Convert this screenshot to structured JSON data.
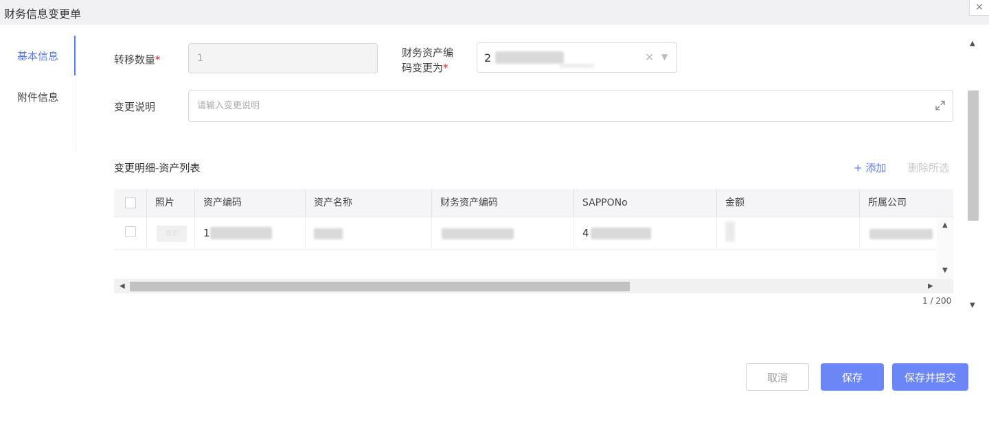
{
  "window": {
    "title": "财务信息变更单",
    "close_label": "✕"
  },
  "nav": {
    "items": [
      {
        "label": "基本信息",
        "active": true
      },
      {
        "label": "附件信息",
        "active": false
      }
    ]
  },
  "form": {
    "transfer_qty_label": "转移数量",
    "transfer_qty_value": "1",
    "fin_code_label_line1": "财务资产编",
    "fin_code_label_line2": "码变更为",
    "fin_code_value": "2",
    "change_desc_label": "变更说明",
    "change_desc_placeholder": "请输入变更说明",
    "required_mark": "*"
  },
  "detail": {
    "section_title": "变更明细-资产列表",
    "add_label": "+ 添加",
    "delete_selected_label": "删除所选",
    "columns": [
      "照片",
      "资产编码",
      "资产名称",
      "财务资产编码",
      "SAPPONo",
      "金额",
      "所属公司"
    ],
    "rows": [
      {
        "asset_code": "1",
        "asset_name": "",
        "fin_asset_code": "",
        "sappono": "4",
        "amount": "",
        "company": ""
      }
    ],
    "photo_thumb_text": "暂无",
    "pager": "1 / 200"
  },
  "footer": {
    "cancel_label": "取消",
    "save_label": "保存",
    "save_submit_label": "保存并提交"
  },
  "colors": {
    "accent": "#5a7bf2",
    "primary_button": "#6b87f7",
    "required": "#f5222d"
  }
}
